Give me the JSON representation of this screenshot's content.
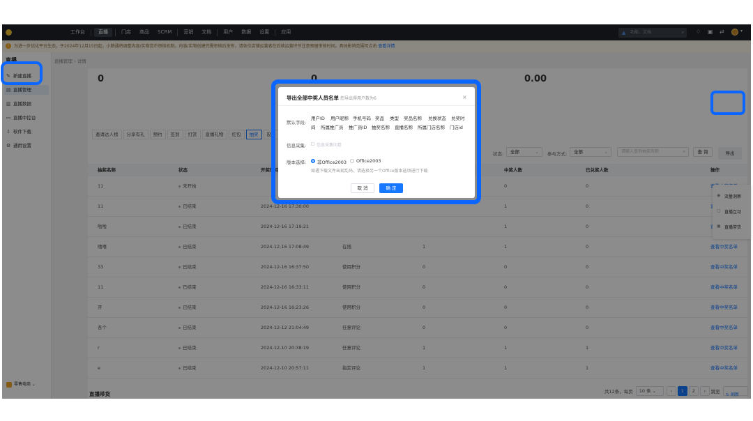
{
  "topbar": {
    "nav": [
      "工作台",
      "直播",
      "门店",
      "商品",
      "SCRM",
      "营销",
      "文档",
      "用户",
      "数据",
      "设置",
      "应用"
    ],
    "active_index": 1,
    "search_placeholder": "功能、文档",
    "icons": [
      "logo-icon",
      "search-icon",
      "notification-icon",
      "clipboard-icon",
      "switch-icon"
    ]
  },
  "notice": {
    "text": "为进一步优化平台生态，于2024年12月15日起，小鹅通将调整内容/实物货币审核机制。内容/实物创建完需审核后发布，请各位店铺运营者在后续运营环节注意预留审核时间。具体影响范围可点击",
    "link": "查看详情"
  },
  "sidebar": {
    "title": "直播",
    "items": [
      {
        "label": "新建直播",
        "icon": "edit-icon"
      },
      {
        "label": "直播管理",
        "icon": "list-icon"
      },
      {
        "label": "直播数据",
        "icon": "chart-icon"
      },
      {
        "label": "直播中控台",
        "icon": "monitor-icon"
      },
      {
        "label": "软件下载",
        "icon": "download-icon"
      },
      {
        "label": "通用设置",
        "icon": "gear-icon"
      }
    ],
    "active_index": 1,
    "footer": "零售电商"
  },
  "breadcrumb": [
    "直播管理",
    "详情"
  ],
  "stats": [
    "0",
    "0",
    "0.00"
  ],
  "tabs": [
    "邀请达人榜",
    "分享有礼",
    "预约",
    "签到",
    "打赏",
    "直播礼物",
    "红包",
    "抽奖",
    "投票"
  ],
  "active_tab": 7,
  "filters": {
    "status_label": "状态:",
    "status_value": "全部",
    "mode_label": "参与方式:",
    "mode_value": "全部",
    "search_placeholder": "请输入查询抽奖名称",
    "query_label": "查 询",
    "export_label": "导出"
  },
  "table": {
    "columns": [
      "抽奖名称",
      "状态",
      "开奖时间",
      "抽奖方式",
      "参与人数",
      "中奖人数",
      "已兑奖人数",
      "操作"
    ],
    "rows": [
      {
        "name": "11",
        "status": "未开始",
        "time": "",
        "mode": "",
        "join": "",
        "win": "0",
        "redeemed": "0",
        "action": "查看中奖名单"
      },
      {
        "name": "11",
        "status": "已结束",
        "time": "2024-12-16 17:30:00",
        "mode": "",
        "join": "",
        "win": "1",
        "redeemed": "0",
        "action": "查看中奖名单"
      },
      {
        "name": "啦啦",
        "status": "已结束",
        "time": "2024-12-16 17:19:21",
        "mode": "",
        "join": "",
        "win": "1",
        "redeemed": "0",
        "action": "查看中奖名单"
      },
      {
        "name": "嘻嘻",
        "status": "已结束",
        "time": "2024-12-16 17:08:49",
        "mode": "在线",
        "join": "1",
        "win": "1",
        "redeemed": "0",
        "action": "查看中奖名单"
      },
      {
        "name": "33",
        "status": "已结束",
        "time": "2024-12-16 16:37:50",
        "mode": "使用积分",
        "join": "0",
        "win": "0",
        "redeemed": "0",
        "action": "查看中奖名单"
      },
      {
        "name": "11",
        "status": "已结束",
        "time": "2024-12-16 16:33:11",
        "mode": "使用积分",
        "join": "0",
        "win": "0",
        "redeemed": "0",
        "action": "查看中奖名单"
      },
      {
        "name": "开",
        "status": "已结束",
        "time": "2024-12-16 16:23:26",
        "mode": "使用积分",
        "join": "0",
        "win": "0",
        "redeemed": "0",
        "action": "查看中奖名单"
      },
      {
        "name": "各个",
        "status": "已结束",
        "time": "2024-12-12 21:04:49",
        "mode": "任意评论",
        "join": "0",
        "win": "0",
        "redeemed": "0",
        "action": "查看中奖名单"
      },
      {
        "name": "r",
        "status": "已结束",
        "time": "2024-12-10 20:38:19",
        "mode": "任意评论",
        "join": "1",
        "win": "1",
        "redeemed": "1",
        "action": "查看中奖名单"
      },
      {
        "name": "e",
        "status": "已结束",
        "time": "2024-12-10 20:57:11",
        "mode": "指定评论",
        "join": "1",
        "win": "1",
        "redeemed": "1",
        "action": "查看中奖名单"
      }
    ]
  },
  "pagination": {
    "total": "共12条，每页",
    "page_size": "10 条",
    "pages": [
      "1",
      "2"
    ],
    "current": "1",
    "jump_label": "跳至",
    "page_unit": "页"
  },
  "bottom": {
    "title": "直播带货",
    "refresh": "刷新"
  },
  "float_panel": [
    {
      "label": "流量洞察",
      "icon": "eye-icon"
    },
    {
      "label": "直播互动",
      "icon": "chat-icon"
    },
    {
      "label": "直播带货",
      "icon": "bag-icon"
    }
  ],
  "modal": {
    "title": "导出全部中奖人员名单",
    "subtitle": "您导出得用户数为6",
    "default_fields_label": "默认字段:",
    "fields_row1": [
      "用户ID",
      "用户昵称",
      "手机号码",
      "奖品",
      "类型",
      "奖品名称",
      "兑换状态",
      "兑奖时"
    ],
    "fields_row2": [
      "间",
      "所属推广员",
      "推广员ID",
      "抽奖名称",
      "直播名称",
      "所属门店名称",
      "门店id"
    ],
    "info_label": "信息采集:",
    "info_option": "信息采集问卷",
    "version_label": "版本选择:",
    "version_options": [
      "非Office2003",
      "Office2003"
    ],
    "version_selected": 0,
    "hint": "如遇下载文件出现乱码，请选择另一个Office版本选项进行下载",
    "cancel": "取 消",
    "confirm": "确 定"
  },
  "colors": {
    "accent": "#1677ff",
    "highlight": "#0a66ff",
    "topbar": "#1f2227"
  }
}
